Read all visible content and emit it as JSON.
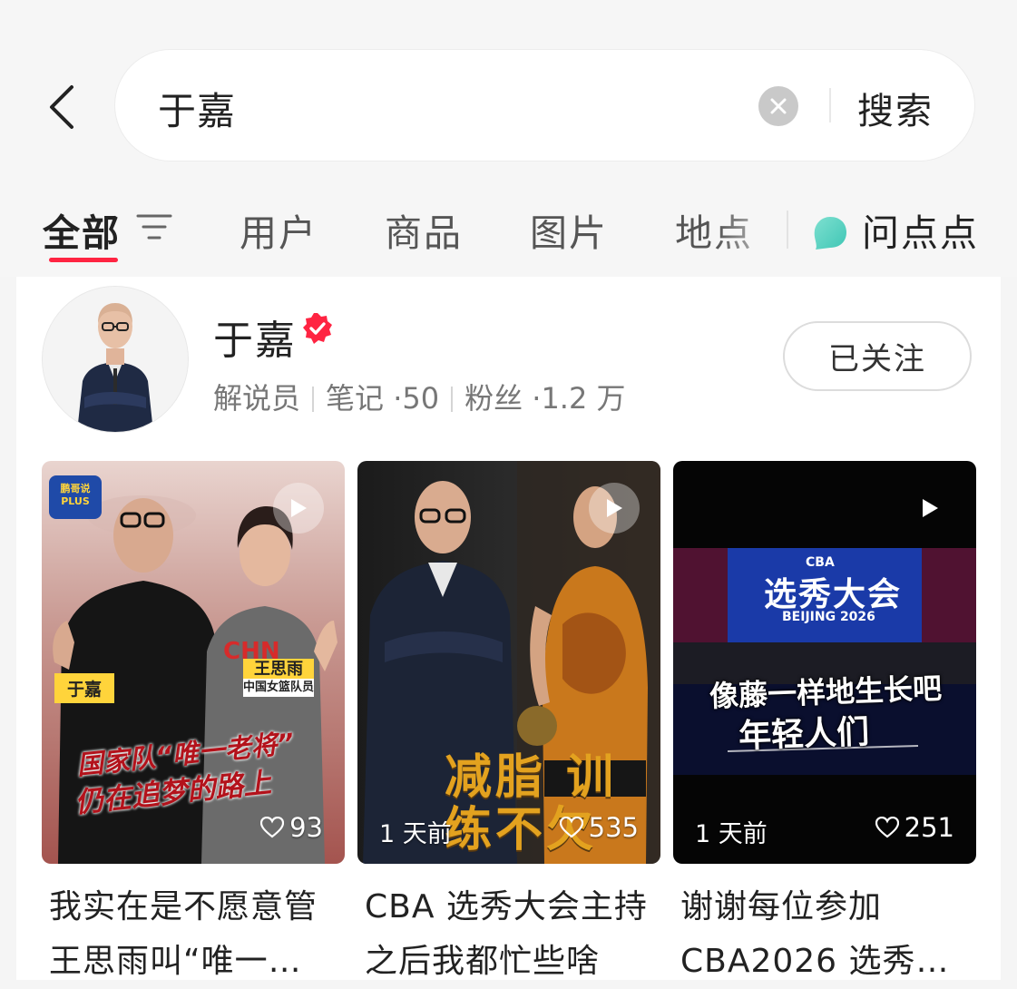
{
  "search": {
    "query": "于嘉",
    "button_label": "搜索"
  },
  "tabs": [
    {
      "label": "全部",
      "active": true
    },
    {
      "label": "用户"
    },
    {
      "label": "商品"
    },
    {
      "label": "图片"
    },
    {
      "label": "地点"
    },
    {
      "label": "问点点"
    }
  ],
  "user": {
    "name": "于嘉",
    "role": "解说员",
    "notes": "笔记 ·50",
    "fans": "粉丝 ·1.2 万",
    "follow_label": "已关注"
  },
  "notes": [
    {
      "title": "我实在是不愿意管王思雨叫“唯一…",
      "likes": "93",
      "time": "",
      "overlay": {
        "logo": "鹏哥说 PLUS",
        "name_tag_left": "于嘉",
        "name_tag_right": "王思雨",
        "sub_tag_right": "中国女篮队员",
        "shirt": "CHN",
        "caption_line1": "国家队“唯一老将”",
        "caption_line2": "仍在追梦的路上"
      }
    },
    {
      "title": "CBA 选秀大会主持之后我都忙些啥",
      "likes": "535",
      "time": "1 天前",
      "overlay": {
        "caption": "减脂 训练不欠"
      }
    },
    {
      "title": "谢谢每位参加 CBA2026 选秀…",
      "likes": "251",
      "time": "1 天前",
      "overlay": {
        "screen_title": "选秀大会",
        "screen_sub": "BEIJING 2026",
        "screen_logo": "CBA",
        "caption_line1": "像藤一样地生长吧",
        "caption_line2": "年轻人们"
      }
    }
  ],
  "colors": {
    "accent": "#ff2442",
    "verified": "#ff2442"
  }
}
